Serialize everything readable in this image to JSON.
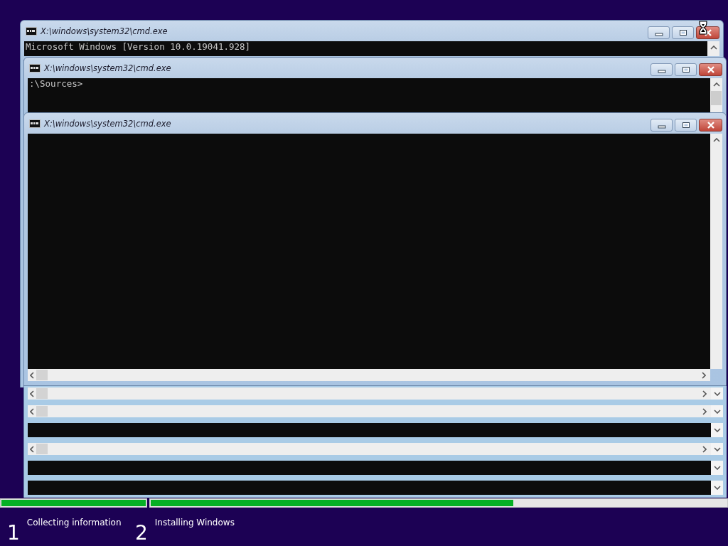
{
  "windows": [
    {
      "title": "X:\\windows\\system32\\cmd.exe",
      "lines": [
        "Microsoft Windows [Version 10.0.19041.928]"
      ]
    },
    {
      "title": "X:\\windows\\system32\\cmd.exe",
      "lines": [
        ":\\Sources>"
      ]
    },
    {
      "title": "X:\\windows\\system32\\cmd.exe"
    }
  ],
  "remnant_strips": [
    {
      "kind": "hscroll"
    },
    {
      "kind": "hscroll"
    },
    {
      "kind": "console"
    },
    {
      "kind": "hscroll"
    },
    {
      "kind": "console"
    },
    {
      "kind": "console"
    }
  ],
  "busy_cursor": true,
  "steps": [
    {
      "number": "1",
      "label": "Collecting information",
      "level": 1
    },
    {
      "number": "2",
      "label": "Installing Windows",
      "level": 0.63
    }
  ]
}
